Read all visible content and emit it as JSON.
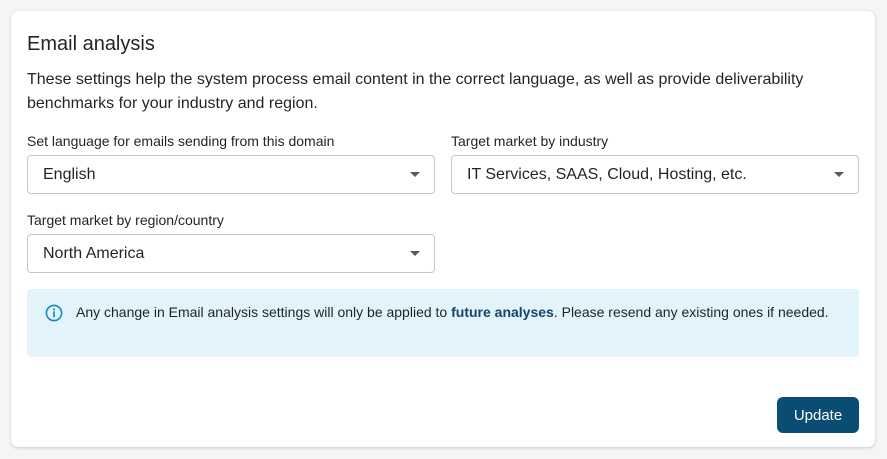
{
  "panel": {
    "title": "Email analysis",
    "description": "These settings help the system process email content in the correct language, as well as provide deliverability benchmarks for your industry and region."
  },
  "fields": {
    "language": {
      "label": "Set language for emails sending from this domain",
      "value": "English"
    },
    "industry": {
      "label": "Target market by industry",
      "value": "IT Services, SAAS, Cloud, Hosting, etc."
    },
    "region": {
      "label": "Target market by region/country",
      "value": "North America"
    }
  },
  "notice": {
    "icon": "info-icon",
    "text_before": "Any change in Email analysis settings will only be applied to ",
    "text_bold": "future analyses",
    "text_after": ". Please resend any existing ones if needed."
  },
  "actions": {
    "update_label": "Update"
  },
  "colors": {
    "primary_button": "#0a4d73",
    "notice_background": "#e3f3fa",
    "info_icon": "#1a8ac4",
    "bold_text": "#13446a"
  }
}
